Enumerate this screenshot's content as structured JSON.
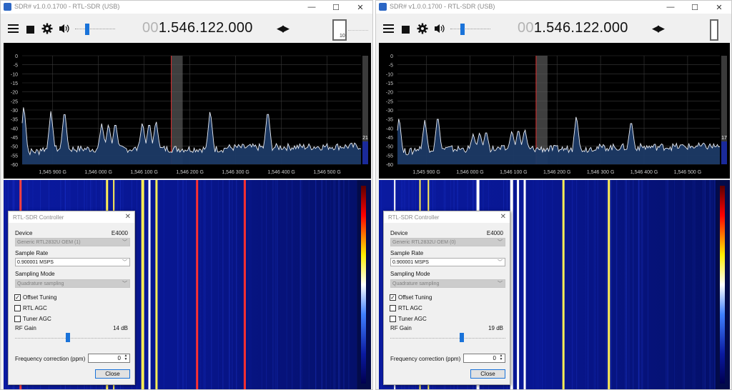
{
  "windows": [
    {
      "title": "SDR# v1.0.0.1700 - RTL-SDR (USB)",
      "frequency_lead": "00",
      "frequency_main": "1.546.122.000",
      "zoom_value": "10",
      "snr_value": "21",
      "dialog": {
        "title": "RTL-SDR Controller",
        "device_label": "Device",
        "device_tuner": "E4000",
        "device_value": "Generic RTL2832U OEM (1)",
        "sample_rate_label": "Sample Rate",
        "sample_rate_value": "0.900001 MSPS",
        "sampling_mode_label": "Sampling Mode",
        "sampling_mode_value": "Quadrature sampling",
        "offset_tuning_label": "Offset Tuning",
        "offset_tuning_checked": true,
        "rtl_agc_label": "RTL AGC",
        "rtl_agc_checked": false,
        "tuner_agc_label": "Tuner AGC",
        "tuner_agc_checked": false,
        "rf_gain_label": "RF Gain",
        "rf_gain_value": "14 dB",
        "rf_gain_fraction": 0.5,
        "freq_corr_label": "Frequency correction (ppm)",
        "freq_corr_value": "0",
        "close_label": "Close"
      }
    },
    {
      "title": "SDR# v1.0.0.1700 - RTL-SDR (USB)",
      "frequency_lead": "00",
      "frequency_main": "1.546.122.000",
      "zoom_value": "",
      "snr_value": "17",
      "dialog": {
        "title": "RTL-SDR Controller",
        "device_label": "Device",
        "device_tuner": "E4000",
        "device_value": "Generic RTL2832U OEM (0)",
        "sample_rate_label": "Sample Rate",
        "sample_rate_value": "0.900001 MSPS",
        "sampling_mode_label": "Sampling Mode",
        "sampling_mode_value": "Quadrature sampling",
        "offset_tuning_label": "Offset Tuning",
        "offset_tuning_checked": true,
        "rtl_agc_label": "RTL AGC",
        "rtl_agc_checked": false,
        "tuner_agc_label": "Tuner AGC",
        "tuner_agc_checked": false,
        "rf_gain_label": "RF Gain",
        "rf_gain_value": "19 dB",
        "rf_gain_fraction": 0.68,
        "freq_corr_label": "Frequency correction (ppm)",
        "freq_corr_value": "0",
        "close_label": "Close"
      }
    }
  ],
  "window_buttons": [
    "—",
    "☐",
    "✕"
  ],
  "icons": [
    "menu-icon",
    "stop-icon",
    "gear-icon",
    "speaker-icon",
    "volume-slider",
    "zoom-slider"
  ],
  "spectrum_axis": {
    "y_ticks": [
      "0",
      "-5",
      "-10",
      "-15",
      "-20",
      "-25",
      "-30",
      "-35",
      "-40",
      "-45",
      "-50",
      "-55",
      "-60"
    ],
    "x_ticks": [
      "1,545 900 G",
      "1,546 000 G",
      "1,546 100 G",
      "1,546 200 G",
      "1,546 300 G",
      "1,546 400 G",
      "1,546 500 G"
    ]
  },
  "colors": {
    "spectrum_fill": "#1c3a66",
    "trace": "#e8ecf4",
    "tuning_line": "#e03030",
    "waterfall_bg": "#030b4a"
  }
}
